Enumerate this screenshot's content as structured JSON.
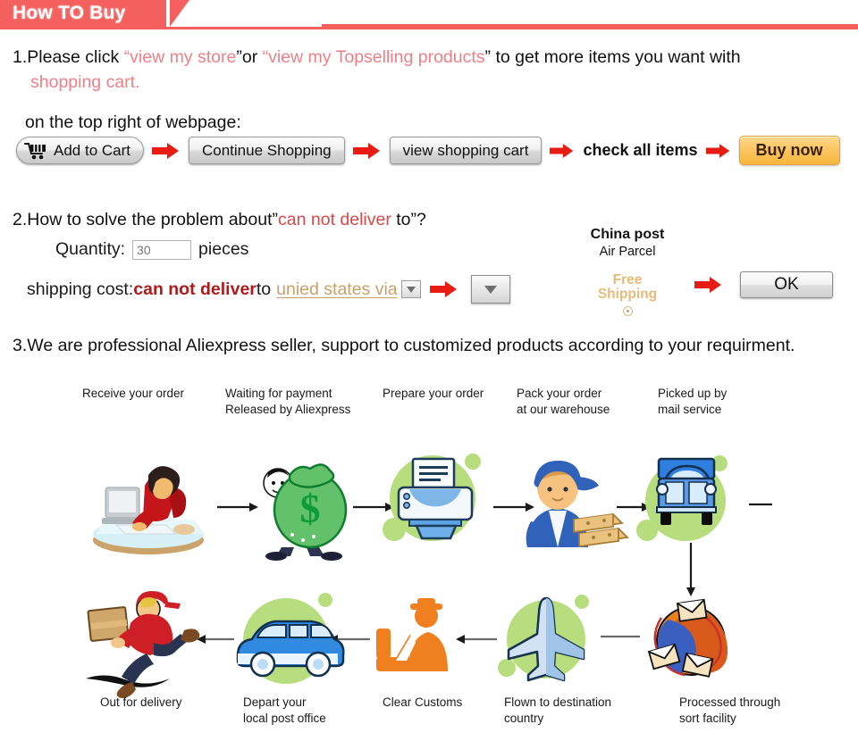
{
  "header": {
    "title": "How TO Buy",
    "accent_color": "#f4605e"
  },
  "step1": {
    "number": "1.",
    "text_a": "Please click ",
    "quote_open": "“",
    "link1": "view my store",
    "quote_close": "”",
    "text_b": "or ",
    "link2": "view my Topselling products",
    "text_c": " to get more items you want with",
    "line2": "shopping cart.",
    "line3": "on the top right of webpage:",
    "link_color": "#ef8088"
  },
  "buttons": {
    "add_to_cart": "Add to Cart",
    "continue_shopping": "Continue Shopping",
    "view_shopping_cart": "view shopping cart",
    "check_all_items": "check all items",
    "buy_now": "Buy now",
    "cart_icon": "shopping-cart-icon",
    "arrow_icon": "right-arrow-icon",
    "buy_now_color": "#f7b73f",
    "arrow_color": "#e81c12"
  },
  "step2": {
    "number": "2.",
    "text_a": "How to solve the problem about",
    "quote_open": "”",
    "highlight": "can not deliver",
    "text_b": " to",
    "quote_close": "”?",
    "quantity_label": "Quantity:",
    "quantity_value": "30",
    "quantity_unit": "pieces",
    "shipping_label": "shipping cost:",
    "shipping_error": "can not deliver",
    "shipping_to": " to ",
    "country_select": "unied states via",
    "error_color": "#b01a1a",
    "country_link_color": "#caa06a",
    "china_post_title": "China post",
    "china_post_sub": "Air Parcel",
    "free_shipping_line1": "Free",
    "free_shipping_line2": "Shipping",
    "ok_label": "OK",
    "dropdown_icon": "chevron-down-icon",
    "radio_icon": "radio-selected-icon"
  },
  "step3": {
    "number": "3.",
    "text": "We are professional Aliexpress seller, support to customized products according to your requirment."
  },
  "flow": {
    "top_captions": [
      {
        "text": "Receive your order",
        "icon": "person-at-computer-icon"
      },
      {
        "text": "Waiting for payment\nReleased by Aliexpress",
        "icon": "money-bag-icon"
      },
      {
        "text": "Prepare your order",
        "icon": "printer-icon"
      },
      {
        "text": "Pack your order\nat our warehouse",
        "icon": "warehouse-worker-icon"
      },
      {
        "text": "Picked up by\nmail service",
        "icon": "delivery-truck-icon"
      }
    ],
    "top_captions_flat": [
      "Receive your order",
      "Waiting for payment",
      "Released by Aliexpress",
      "Prepare your order",
      "Pack your order",
      "at our warehouse",
      "Picked up by",
      "mail service"
    ],
    "bottom_captions_flat": [
      "Out for delivery",
      "Depart your",
      "local post office",
      "Clear Customs",
      "Flown to destination",
      "country",
      "Processed through",
      "sort facility"
    ],
    "bottom_captions": [
      {
        "text": "Out for delivery",
        "icon": "running-courier-icon"
      },
      {
        "text": "Depart your\nlocal post office",
        "icon": "delivery-van-icon"
      },
      {
        "text": "Clear Customs",
        "icon": "customs-officer-icon"
      },
      {
        "text": "Flown to destination\ncountry",
        "icon": "airplane-icon"
      },
      {
        "text": "Processed through\nsort facility",
        "icon": "mail-sorting-globe-icon"
      }
    ],
    "arrow_icon": "flow-arrow-icon",
    "blob_color": "#b8dd7e"
  }
}
